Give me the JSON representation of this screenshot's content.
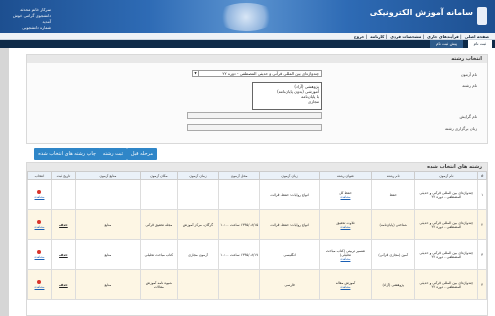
{
  "header": {
    "logo_text": "سامانه آموزش الکترونیکی",
    "user_lines": [
      "سرکار خانم محدثه",
      "دانشجوی گرامی خوش آمدید",
      "شماره دانشجویی"
    ]
  },
  "nav": {
    "items": [
      "صفحه اصلی",
      "| فرآیندهای جاری",
      "| مشخصات فردی",
      "| کارنامه",
      "| خروج"
    ]
  },
  "tabs": [
    {
      "label": "ثبت نام"
    },
    {
      "label": "پیش ثبت نام"
    }
  ],
  "selection_panel": {
    "title": "انتخاب رشته",
    "course_label": "نام آزمون",
    "course_value": "چندواژه‌ای بین المللی قرآنی و حدیثی المصطفی - دوره ۲۲",
    "field_label": "نام رشته",
    "field_options": [
      "پژوهشی (آزاد)",
      "آموزشی (بدون پایان‌نامه)",
      "با پایان‌نامه",
      "مجازی"
    ],
    "selected_field_label": "نام گرایش",
    "study_lang_label": "زبان برگزاری رشته",
    "dropdown_arrow": "▼"
  },
  "buttons": {
    "prev": "مرحله قبل",
    "save": "ثبت رشته",
    "print": "چاپ رشته های انتخاب شده"
  },
  "table": {
    "title": "رشته های انتخاب شده",
    "headers": [
      "#",
      "نام آزمون",
      "نام رشته",
      "عنوان رشته",
      "زبان آزمون",
      "محل آزمون",
      "زمان آزمون",
      "مکان آزمون",
      "منابع آزمون",
      "تاریخ ثبت",
      "انتخاب"
    ],
    "rows": [
      {
        "num": "۱",
        "exam": "چندواژه‌ای بین المللی قرآنی و حدیثی المصطفی - دوره ۲۲",
        "field": "حفظ",
        "title": "حفظ کل",
        "lang": "انواع روایات: حفظ، قرائت",
        "place": "",
        "time": "",
        "venue": "",
        "sources": "",
        "reg": "",
        "link": "مشاهده"
      },
      {
        "num": "۲",
        "exam": "چندواژه‌ای بین المللی قرآنی و حدیثی المصطفی - دوره ۲۲",
        "field": "شناختی (پایان‌نامه)",
        "title": "تلاوت تحقیق",
        "lang": "انواع روایات: حفظ، قرائت",
        "place": "۱۳۹۵/۰۸/۱۵ ساعت ۱۰:۰۰",
        "time": "گرگان، مرکز آموزش",
        "venue": "مجله تحقیق قرآنی",
        "sources": "منابع",
        "reg": "حذف",
        "link": "مشاهده"
      },
      {
        "num": "۳",
        "exam": "چندواژه‌ای بین المللی قرآنی و حدیثی المصطفی - دوره ۲۲",
        "field": "آمین (مجازی قرآنی)",
        "title": "تفسیر تربیتی (کتاب مباحث تحلیلی)",
        "lang": "انگلیسی",
        "place": "۱۳۹۵/۰۸/۱۷ ساعت ۱۰:۰۰",
        "time": "آزمون مجازی",
        "venue": "کتاب مباحث تحلیلی",
        "sources": "منابع",
        "reg": "حذف",
        "link": "مشاهده"
      },
      {
        "num": "۴",
        "exam": "چندواژه‌ای بین المللی قرآنی و حدیثی المصطفی - دوره ۲۲",
        "field": "پژوهشی (آزاد)",
        "title": "آموزش مقاله",
        "lang": "فارسی",
        "place": "",
        "time": "",
        "venue": "شیوه نامه آموزش مقالات",
        "sources": "منابع",
        "reg": "حذف",
        "link": "مشاهده"
      }
    ]
  },
  "colors": {
    "banner": "#2e6bb5",
    "tabbar": "#0e2a48",
    "button": "#2f86c8",
    "delete": "#d9342b",
    "row_alt": "#fdf6e4"
  }
}
